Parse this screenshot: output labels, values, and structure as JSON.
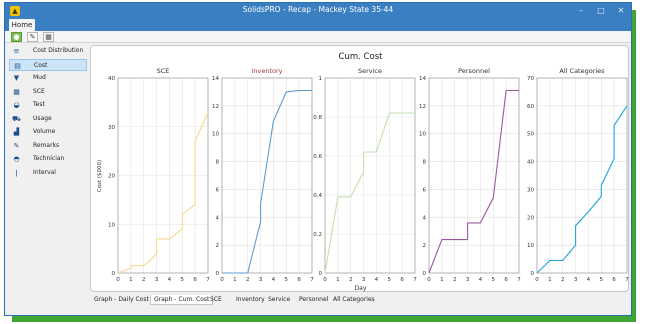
{
  "window": {
    "title": "SolidsPRO - Recap - Mackey State 35-44",
    "minimize": "–",
    "maximize": "□",
    "close": "✕"
  },
  "ribbon": {
    "tab_home": "Home"
  },
  "sidebar": {
    "items": [
      {
        "label": "Cost Distribution",
        "icon": "cost-distribution-icon",
        "selected": false
      },
      {
        "label": "Cost",
        "icon": "cost-icon",
        "selected": true
      },
      {
        "label": "Mud",
        "icon": "mud-icon",
        "selected": false
      },
      {
        "label": "SCE",
        "icon": "sce-icon",
        "selected": false
      },
      {
        "label": "Test",
        "icon": "test-icon",
        "selected": false
      },
      {
        "label": "Usage",
        "icon": "usage-icon",
        "selected": false
      },
      {
        "label": "Volume",
        "icon": "volume-icon",
        "selected": false
      },
      {
        "label": "Remarks",
        "icon": "remarks-icon",
        "selected": false
      },
      {
        "label": "Technician",
        "icon": "technician-icon",
        "selected": false
      },
      {
        "label": "Interval",
        "icon": "interval-icon",
        "selected": false
      }
    ]
  },
  "bottom_tabs": [
    {
      "label": "Graph - Daily Cost",
      "active": false
    },
    {
      "label": "Graph - Cum. Cost",
      "active": true
    },
    {
      "label": "SCE",
      "active": false
    },
    {
      "label": "Inventory",
      "active": false
    },
    {
      "label": "Service",
      "active": false
    },
    {
      "label": "Personnel",
      "active": false
    },
    {
      "label": "All Categories",
      "active": false
    }
  ],
  "chart_data": {
    "type": "line",
    "title": "Cum. Cost",
    "xlabel": "Day",
    "ylabel": "Cost ($000)",
    "grid": true,
    "x": [
      0,
      1,
      2,
      3,
      4,
      5,
      6,
      7
    ],
    "panels": [
      {
        "title": "SCE",
        "color": "#f5d98a",
        "ylim": [
          0,
          40
        ],
        "yticks": [
          0,
          10,
          20,
          30,
          40
        ],
        "points": [
          [
            0,
            0
          ],
          [
            1,
            1
          ],
          [
            1,
            1.5
          ],
          [
            2,
            1.5
          ],
          [
            2.5,
            2.5
          ],
          [
            3,
            4
          ],
          [
            3,
            7
          ],
          [
            4,
            7
          ],
          [
            5,
            9
          ],
          [
            5,
            12
          ],
          [
            6,
            14
          ],
          [
            6,
            27
          ],
          [
            7,
            33
          ]
        ]
      },
      {
        "title": "Inventory",
        "color": "#5b9bd5",
        "ylim": [
          0,
          14
        ],
        "yticks": [
          0,
          2,
          4,
          6,
          8,
          10,
          12,
          14
        ],
        "points": [
          [
            0,
            0
          ],
          [
            2,
            0
          ],
          [
            3,
            3.7
          ],
          [
            3,
            5
          ],
          [
            4,
            10.9
          ],
          [
            5,
            13
          ],
          [
            6,
            13.1
          ],
          [
            7,
            13.1
          ]
        ]
      },
      {
        "title": "Service",
        "color": "#c5e0b4",
        "ylim": [
          0,
          1
        ],
        "yticks": [
          0,
          0.2,
          0.4,
          0.6,
          0.8,
          1
        ],
        "points": [
          [
            0,
            0
          ],
          [
            1,
            0.39
          ],
          [
            2,
            0.39
          ],
          [
            3,
            0.52
          ],
          [
            3,
            0.62
          ],
          [
            4,
            0.62
          ],
          [
            5,
            0.82
          ],
          [
            6,
            0.82
          ],
          [
            7,
            0.82
          ]
        ]
      },
      {
        "title": "Personnel",
        "color": "#9e56a0",
        "ylim": [
          0,
          14
        ],
        "yticks": [
          0,
          2,
          4,
          6,
          8,
          10,
          12,
          14
        ],
        "points": [
          [
            0,
            0
          ],
          [
            1,
            2.4
          ],
          [
            2,
            2.4
          ],
          [
            3,
            2.4
          ],
          [
            3,
            3.6
          ],
          [
            4,
            3.6
          ],
          [
            5,
            5.4
          ],
          [
            6,
            13.1
          ],
          [
            7,
            13.1
          ]
        ]
      },
      {
        "title": "All Categories",
        "color": "#1aa3d9",
        "ylim": [
          0,
          70
        ],
        "yticks": [
          0,
          10,
          20,
          30,
          40,
          50,
          60,
          70
        ],
        "points": [
          [
            0,
            0
          ],
          [
            1,
            4.5
          ],
          [
            2,
            4.5
          ],
          [
            3,
            10
          ],
          [
            3,
            17
          ],
          [
            4,
            22
          ],
          [
            5,
            27.5
          ],
          [
            5,
            31.5
          ],
          [
            6,
            41
          ],
          [
            6,
            53
          ],
          [
            7,
            60
          ]
        ]
      }
    ]
  }
}
